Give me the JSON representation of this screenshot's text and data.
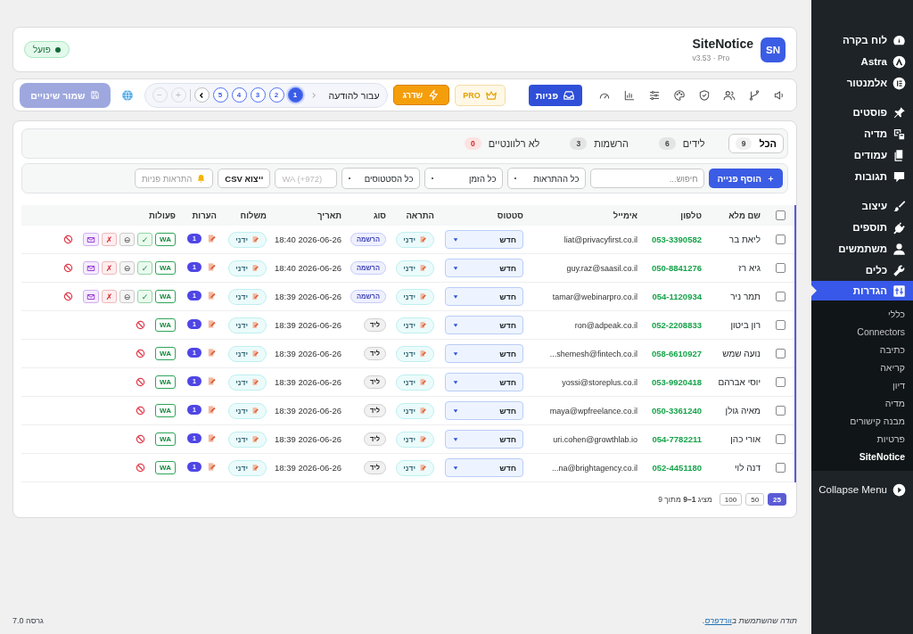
{
  "sidebar": {
    "groups": [
      [
        {
          "label": "לוח בקרה",
          "selected": false
        },
        {
          "label": "Astra",
          "selected": false
        },
        {
          "label": "אלמנטור",
          "selected": false
        }
      ],
      [
        {
          "label": "פוסטים",
          "selected": false
        },
        {
          "label": "מדיה",
          "selected": false
        },
        {
          "label": "עמודים",
          "selected": false
        },
        {
          "label": "תגובות",
          "selected": false
        }
      ],
      [
        {
          "label": "עיצוב",
          "selected": false
        },
        {
          "label": "תוספים",
          "selected": false
        },
        {
          "label": "משתמשים",
          "selected": false
        },
        {
          "label": "כלים",
          "selected": false
        },
        {
          "label": "הגדרות",
          "selected": true,
          "submenu": [
            {
              "label": "כללי",
              "selected": false
            },
            {
              "label": "Connectors",
              "selected": false
            },
            {
              "label": "כתיבה",
              "selected": false
            },
            {
              "label": "קריאה",
              "selected": false
            },
            {
              "label": "דיון",
              "selected": false
            },
            {
              "label": "מדיה",
              "selected": false
            },
            {
              "label": "מבנה קישורים",
              "selected": false
            },
            {
              "label": "פרטיות",
              "selected": false
            },
            {
              "label": "SiteNotice",
              "selected": true
            }
          ]
        }
      ]
    ],
    "collapse_label": "Collapse Menu"
  },
  "header": {
    "logo": "SN",
    "title": "SiteNotice",
    "subtitle": "v3.53 · Pro",
    "status": {
      "label": "פועל",
      "on": true
    }
  },
  "toolbar": {
    "nav": [
      {
        "selected": false
      },
      {
        "selected": false
      },
      {
        "selected": false
      },
      {
        "selected": false
      },
      {
        "selected": false
      },
      {
        "selected": false
      },
      {
        "selected": false
      },
      {
        "selected": false
      },
      {
        "label": "פניות",
        "selected": true
      }
    ],
    "pro_badge": "PRO",
    "upgrade_button": "שדרג",
    "pager": {
      "label": "עבור להודעה",
      "prev_disabled": true,
      "pages": [
        {
          "label": "1",
          "selected": true
        },
        {
          "label": "2",
          "selected": false
        },
        {
          "label": "3",
          "selected": false
        },
        {
          "label": "4",
          "selected": false
        },
        {
          "label": "5",
          "selected": false
        }
      ],
      "add": {
        "label": "+",
        "disabled": true
      },
      "remove": {
        "label": "−",
        "disabled": true
      }
    },
    "save_button": {
      "label": "שמור שינויים",
      "disabled": true
    }
  },
  "tabs": [
    {
      "label": "הכל",
      "count": "9",
      "selected": true,
      "alert": false
    },
    {
      "label": "לידים",
      "count": "6",
      "selected": false,
      "alert": false
    },
    {
      "label": "הרשמות",
      "count": "3",
      "selected": false,
      "alert": false
    },
    {
      "label": "לא רלוונטיים",
      "count": "0",
      "selected": false,
      "alert": true
    }
  ],
  "filters": {
    "add_button": "הוסף פנייה",
    "search": {
      "placeholder": "חיפוש..."
    },
    "selects": [
      "כל ההתראות",
      "כל הזמן",
      "כל הסטטוסים"
    ],
    "wa_field": {
      "placeholder": "WA (+972)"
    },
    "export_button": "ייצוא CSV",
    "alerts_button": {
      "label": "התראות פניות",
      "disabled": true
    }
  },
  "table": {
    "columns": [
      "שם מלא",
      "טלפון",
      "אימייל",
      "סטטוס",
      "התראה",
      "סוג",
      "תאריך",
      "משלוח",
      "הערות",
      "פעולות"
    ],
    "rows": [
      {
        "name": "ליאת בר",
        "phone": "053-3390582",
        "email": "liat@privacyfirst.co.il",
        "status": "חדש",
        "notify": "ידני",
        "type": {
          "label": "הרשמה",
          "kind": "signup"
        },
        "date": "2026-06-26 18:40",
        "sender": "ידני",
        "notes": "1",
        "checked": false,
        "actions": [
          {
            "kind": "wa",
            "label": "WA"
          },
          {
            "kind": "approve",
            "label": "✓"
          },
          {
            "kind": "hold",
            "label": "⊖"
          },
          {
            "kind": "reject",
            "label": "✗"
          },
          {
            "kind": "mail"
          },
          {
            "kind": "block"
          }
        ]
      },
      {
        "name": "גיא רז",
        "phone": "050-8841276",
        "email": "guy.raz@saasil.co.il",
        "status": "חדש",
        "notify": "ידני",
        "type": {
          "label": "הרשמה",
          "kind": "signup"
        },
        "date": "2026-06-26 18:40",
        "sender": "ידני",
        "notes": "1",
        "checked": false,
        "actions": [
          {
            "kind": "wa",
            "label": "WA"
          },
          {
            "kind": "approve",
            "label": "✓"
          },
          {
            "kind": "hold",
            "label": "⊖"
          },
          {
            "kind": "reject",
            "label": "✗"
          },
          {
            "kind": "mail"
          },
          {
            "kind": "block"
          }
        ]
      },
      {
        "name": "תמר ניר",
        "phone": "054-1120934",
        "email": "tamar@webinarpro.co.il",
        "status": "חדש",
        "notify": "ידני",
        "type": {
          "label": "הרשמה",
          "kind": "signup"
        },
        "date": "2026-06-26 18:39",
        "sender": "ידני",
        "notes": "1",
        "checked": false,
        "actions": [
          {
            "kind": "wa",
            "label": "WA"
          },
          {
            "kind": "approve",
            "label": "✓"
          },
          {
            "kind": "hold",
            "label": "⊖"
          },
          {
            "kind": "reject",
            "label": "✗"
          },
          {
            "kind": "mail"
          },
          {
            "kind": "block"
          }
        ]
      },
      {
        "name": "רון ביטון",
        "phone": "052-2208833",
        "email": "ron@adpeak.co.il",
        "status": "חדש",
        "notify": "ידני",
        "type": {
          "label": "ליד",
          "kind": "lead"
        },
        "date": "2026-06-26 18:39",
        "sender": "ידני",
        "notes": "1",
        "checked": false,
        "actions": [
          {
            "kind": "wa",
            "label": "WA"
          },
          {
            "kind": "block"
          }
        ]
      },
      {
        "name": "נועה שמש",
        "phone": "058-6610927",
        "email": "...shemesh@fintech.co.il",
        "status": "חדש",
        "notify": "ידני",
        "type": {
          "label": "ליד",
          "kind": "lead"
        },
        "date": "2026-06-26 18:39",
        "sender": "ידני",
        "notes": "1",
        "checked": false,
        "actions": [
          {
            "kind": "wa",
            "label": "WA"
          },
          {
            "kind": "block"
          }
        ]
      },
      {
        "name": "יוסי אברהם",
        "phone": "053-9920418",
        "email": "yossi@storeplus.co.il",
        "status": "חדש",
        "notify": "ידני",
        "type": {
          "label": "ליד",
          "kind": "lead"
        },
        "date": "2026-06-26 18:39",
        "sender": "ידני",
        "notes": "1",
        "checked": false,
        "actions": [
          {
            "kind": "wa",
            "label": "WA"
          },
          {
            "kind": "block"
          }
        ]
      },
      {
        "name": "מאיה גולן",
        "phone": "050-3361240",
        "email": "maya@wpfreelance.co.il",
        "status": "חדש",
        "notify": "ידני",
        "type": {
          "label": "ליד",
          "kind": "lead"
        },
        "date": "2026-06-26 18:39",
        "sender": "ידני",
        "notes": "1",
        "checked": false,
        "actions": [
          {
            "kind": "wa",
            "label": "WA"
          },
          {
            "kind": "block"
          }
        ]
      },
      {
        "name": "אורי כהן",
        "phone": "054-7782211",
        "email": "uri.cohen@growthlab.io",
        "status": "חדש",
        "notify": "ידני",
        "type": {
          "label": "ליד",
          "kind": "lead"
        },
        "date": "2026-06-26 18:39",
        "sender": "ידני",
        "notes": "1",
        "checked": false,
        "actions": [
          {
            "kind": "wa",
            "label": "WA"
          },
          {
            "kind": "block"
          }
        ]
      },
      {
        "name": "דנה לוי",
        "phone": "052-4451180",
        "email": "...na@brightagency.co.il",
        "status": "חדש",
        "notify": "ידני",
        "type": {
          "label": "ליד",
          "kind": "lead"
        },
        "date": "2026-06-26 18:39",
        "sender": "ידני",
        "notes": "1",
        "checked": false,
        "actions": [
          {
            "kind": "wa",
            "label": "WA"
          },
          {
            "kind": "block"
          }
        ]
      }
    ],
    "select_all_checked": false
  },
  "pagination": {
    "per_page": [
      {
        "label": "25",
        "selected": true
      },
      {
        "label": "50",
        "selected": false
      },
      {
        "label": "100",
        "selected": false
      }
    ],
    "summary": "מציג **1–9** מתוך 9"
  },
  "footer": {
    "credit_before": "תודה שהשתמשת ב",
    "credit_link": "וורדפרס",
    "credit_after": ".",
    "version": "גרסה 7.0"
  }
}
